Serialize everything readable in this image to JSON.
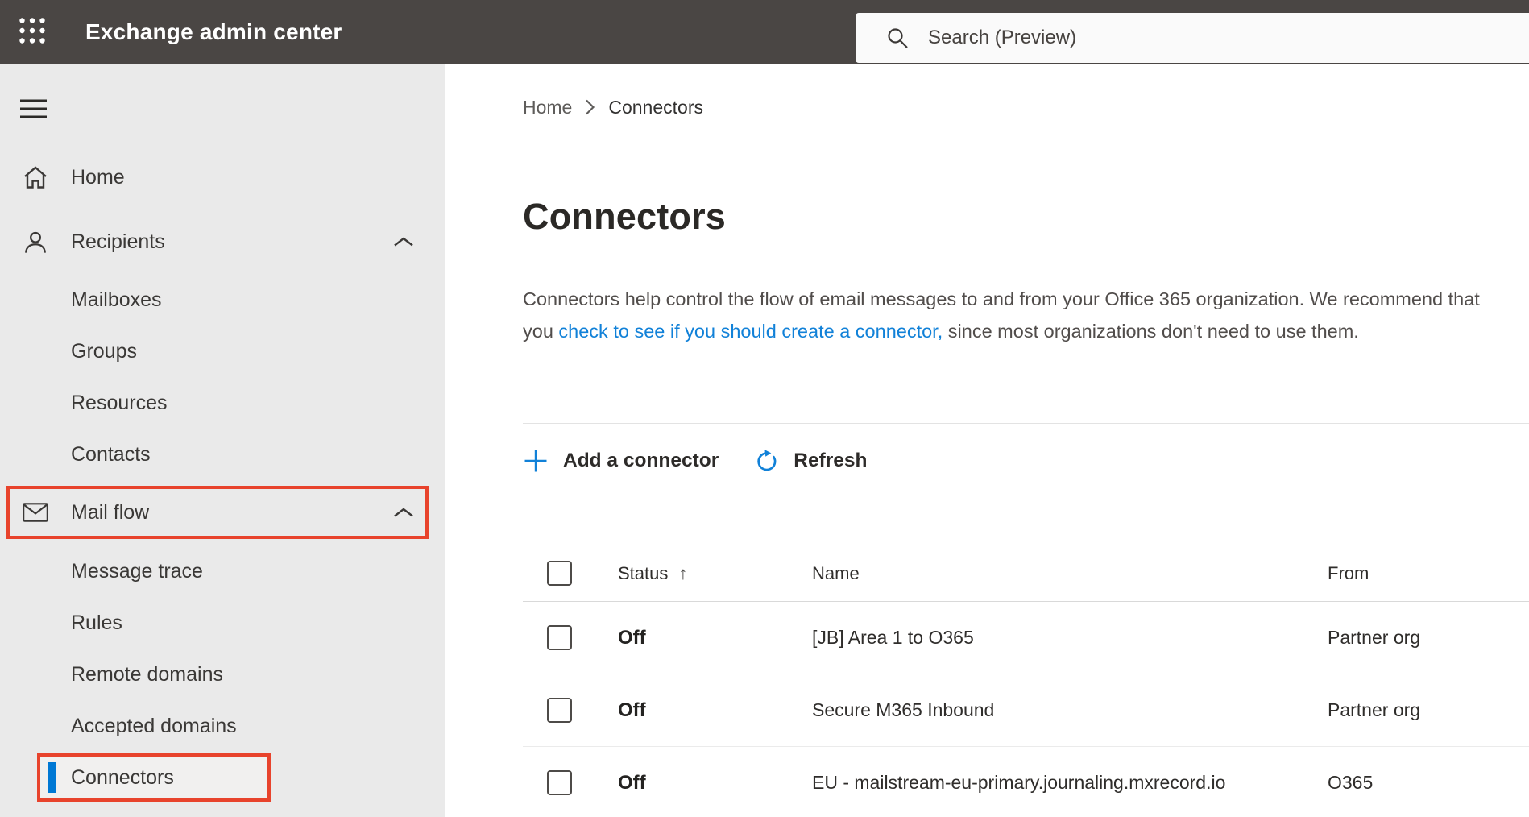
{
  "topbar": {
    "app_title": "Exchange admin center",
    "search_placeholder": "Search (Preview)"
  },
  "sidebar": {
    "items": [
      {
        "label": "Home",
        "icon": "home-icon",
        "level": 1
      },
      {
        "label": "Recipients",
        "icon": "person-icon",
        "level": 1,
        "expanded": true
      },
      {
        "label": "Mailboxes",
        "level": 2
      },
      {
        "label": "Groups",
        "level": 2
      },
      {
        "label": "Resources",
        "level": 2
      },
      {
        "label": "Contacts",
        "level": 2
      },
      {
        "label": "Mail flow",
        "icon": "mail-icon",
        "level": 1,
        "expanded": true,
        "annotated": true
      },
      {
        "label": "Message trace",
        "level": 2
      },
      {
        "label": "Rules",
        "level": 2
      },
      {
        "label": "Remote domains",
        "level": 2
      },
      {
        "label": "Accepted domains",
        "level": 2
      },
      {
        "label": "Connectors",
        "level": 2,
        "selected": true,
        "annotated": true
      }
    ]
  },
  "breadcrumb": {
    "items": [
      "Home",
      "Connectors"
    ]
  },
  "page": {
    "title": "Connectors",
    "description_before_link": "Connectors help control the flow of email messages to and from your Office 365 organization. We recommend that you ",
    "description_link": "check to see if you should create a connector,",
    "description_after_link": " since most organizations don't need to use them."
  },
  "toolbar": {
    "add_label": "Add a connector",
    "refresh_label": "Refresh"
  },
  "table": {
    "columns": [
      "Status",
      "Name",
      "From"
    ],
    "sort": {
      "column": "Status",
      "direction": "asc",
      "glyph": "↑"
    },
    "rows": [
      {
        "status": "Off",
        "name": "[JB] Area 1 to O365",
        "from": "Partner org"
      },
      {
        "status": "Off",
        "name": "Secure M365 Inbound",
        "from": "Partner org"
      },
      {
        "status": "Off",
        "name": "EU - mailstream-eu-primary.journaling.mxrecord.io",
        "from": "O365"
      }
    ]
  },
  "icons": {
    "app-launcher-icon": "3x3-white-dot-grid",
    "search-icon": "magnifier-outline",
    "hamburger-icon": "three-horizontal-lines",
    "home-icon": "house-outline",
    "person-icon": "person-outline",
    "mail-icon": "envelope-outline",
    "chevron-up-icon": "caret-up",
    "breadcrumb-chevron-icon": "caret-right",
    "add-icon": "plus",
    "refresh-icon": "circular-arrow",
    "sort-ascending-icon": "up-arrow"
  },
  "colors": {
    "topbar_bg": "#4a4644",
    "sidebar_bg": "#eaeaea",
    "accent_blue": "#0078d4",
    "link_blue": "#1181d8",
    "annotation_red": "#e8432c",
    "text_primary": "#323130",
    "text_secondary": "#5f5d5b"
  }
}
